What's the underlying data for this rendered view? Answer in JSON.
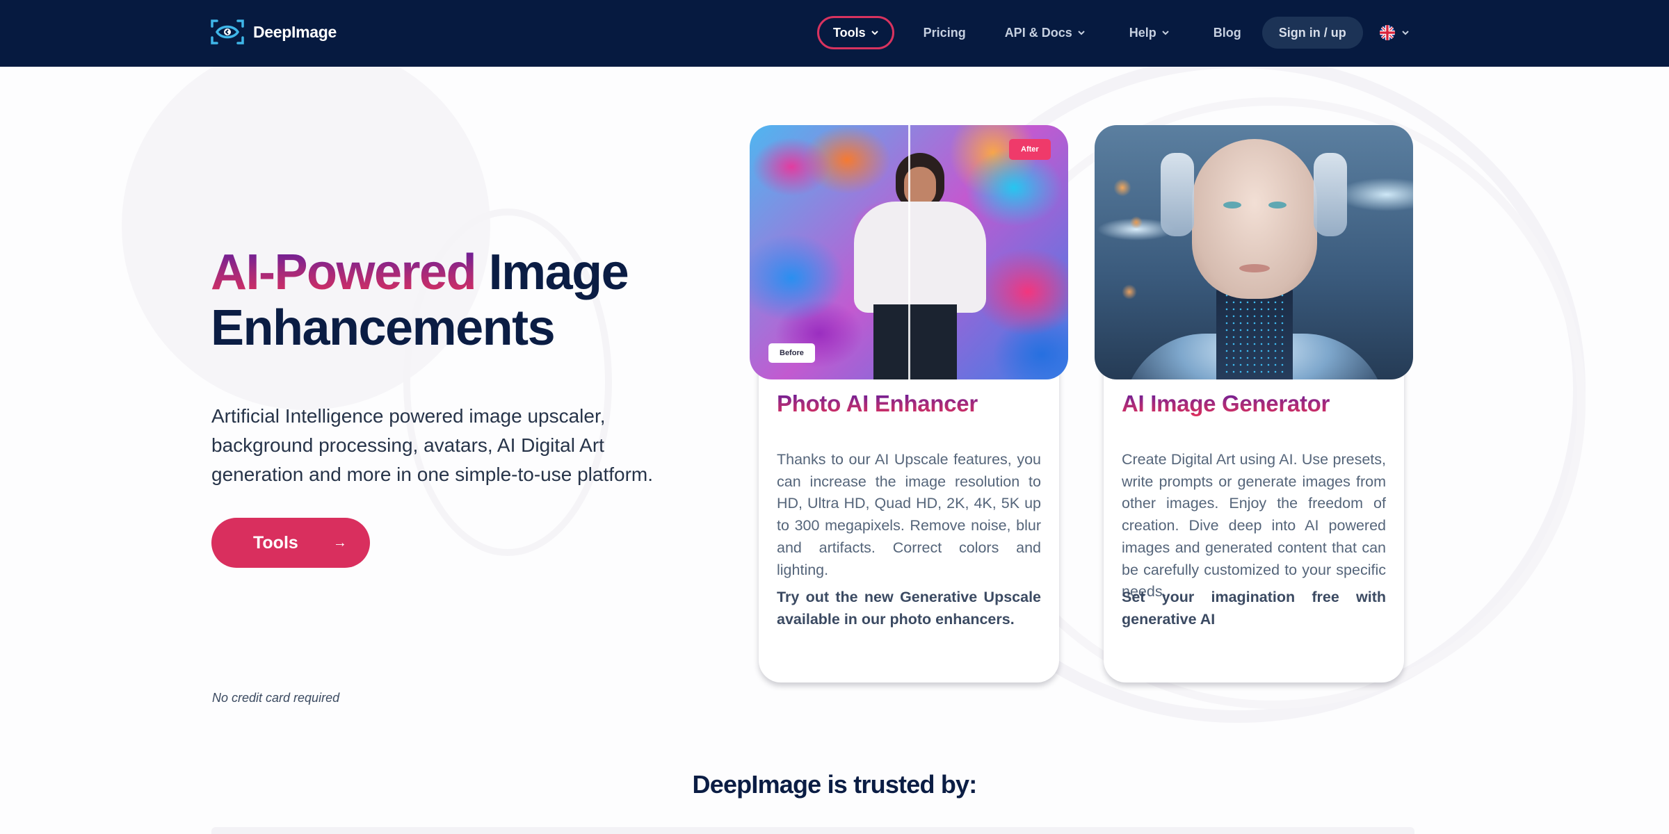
{
  "nav": {
    "brand": "DeepImage",
    "items": [
      {
        "label": "Tools",
        "has_dropdown": true,
        "active": true
      },
      {
        "label": "Pricing",
        "has_dropdown": false
      },
      {
        "label": "API & Docs",
        "has_dropdown": true
      },
      {
        "label": "Help",
        "has_dropdown": true
      },
      {
        "label": "Blog",
        "has_dropdown": false
      }
    ],
    "signin_label": "Sign in / up",
    "language": {
      "icon": "uk-flag-icon",
      "has_dropdown": true
    }
  },
  "hero": {
    "title_highlight": "AI-Powered",
    "title_rest_line1": "Image",
    "title_line2": "Enhancements",
    "description": "Artificial Intelligence powered image upscaler, background processing, avatars, AI Digital Art generation and more in one simple-to-use platform.",
    "cta_label": "Tools",
    "cta_icon": "arrow-right-icon",
    "note": "No credit card required"
  },
  "cards": [
    {
      "title": "Photo AI Enhancer",
      "image": "before-after-graffiti-portrait",
      "before_label": "Before",
      "after_label": "After",
      "text": "Thanks to our AI Upscale features, you can increase the image resolution to HD, Ultra HD, Quad HD, 2K, 4K, 5K up to 300 megapixels. Remove noise, blur and artifacts. Correct colors and lighting.",
      "note": "Try out the new Generative Upscale available in our photo enhancers."
    },
    {
      "title": "AI Image Generator",
      "image": "ai-generated-cyborg-portrait",
      "text": "Create Digital Art using AI. Use presets, write prompts or generate images from other images. Enjoy the freedom of creation. Dive deep into AI powered images and generated content that can be carefully customized to your specific needs.",
      "note": "Set your imagination free with generative AI"
    }
  ],
  "trusted": {
    "heading": "DeepImage is trusted by:"
  },
  "colors": {
    "nav_bg": "#061a40",
    "accent": "#d92f5e",
    "heading": "#0b1d44",
    "gradient_start": "#5a1aa0",
    "gradient_end": "#e2305a"
  }
}
